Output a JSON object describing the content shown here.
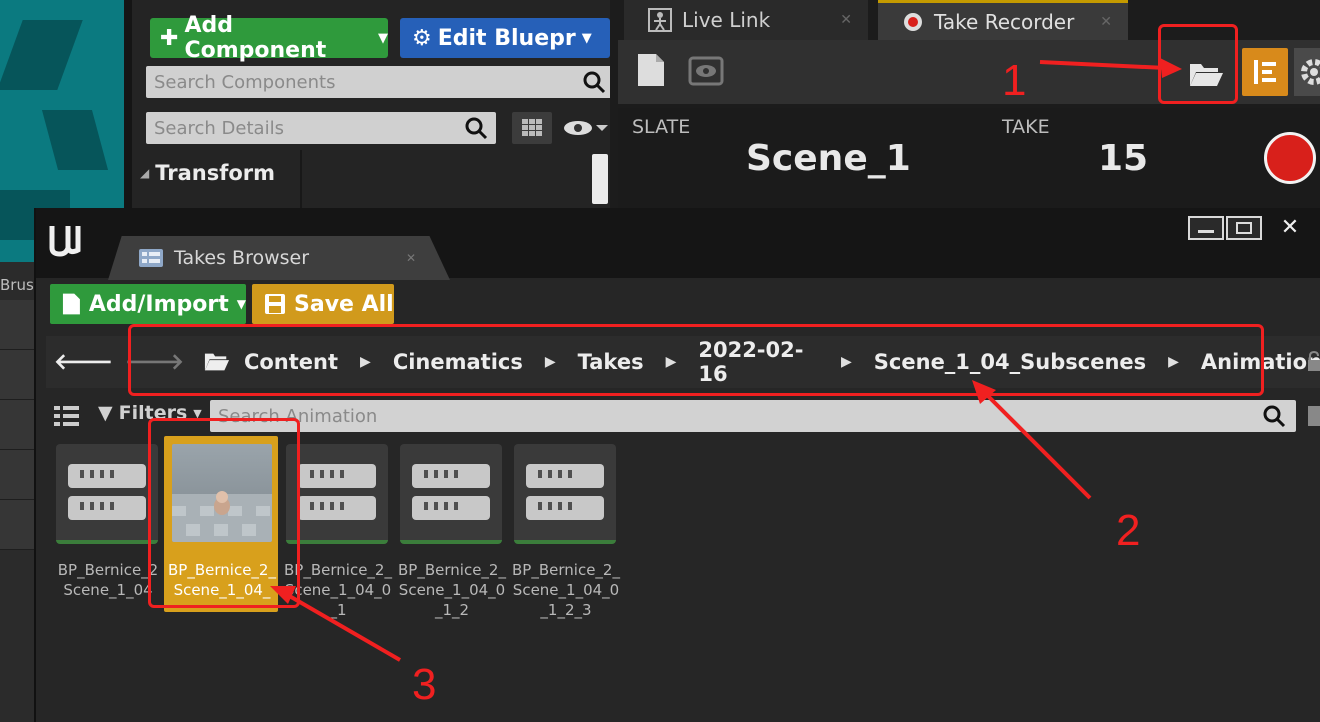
{
  "details": {
    "add_component": "Add Component",
    "edit_blueprint": "Edit Bluepr",
    "search_components_placeholder": "Search Components",
    "search_details_placeholder": "Search Details",
    "transform_label": "Transform"
  },
  "left": {
    "brush_label": "Brus"
  },
  "recorder": {
    "tab_live_link": "Live Link",
    "tab_take_recorder": "Take Recorder",
    "slate_label": "SLATE",
    "slate_value": "Scene_1",
    "take_label": "TAKE",
    "take_value": "15"
  },
  "takes_browser": {
    "tab_title": "Takes Browser",
    "add_import": "Add/Import",
    "save_all": "Save All",
    "breadcrumbs": [
      "Content",
      "Cinematics",
      "Takes",
      "2022-02-16",
      "Scene_1_04_Subscenes",
      "Animation"
    ],
    "filters_label": "Filters",
    "search_placeholder": "Search Animation",
    "assets": [
      {
        "name_line1": "BP_Bernice_2",
        "name_line2": "Scene_1_04"
      },
      {
        "name_line1": "BP_Bernice_2_",
        "name_line2": "Scene_1_04_"
      },
      {
        "name_line1": "BP_Bernice_2_",
        "name_line2": "Scene_1_04_0",
        "name_line3": "_1"
      },
      {
        "name_line1": "BP_Bernice_2_",
        "name_line2": "Scene_1_04_0",
        "name_line3": "_1_2"
      },
      {
        "name_line1": "BP_Bernice_2_",
        "name_line2": "Scene_1_04_0",
        "name_line3": "_1_2_3"
      }
    ]
  },
  "annotations": {
    "n1": "1",
    "n2": "2",
    "n3": "3"
  },
  "colors": {
    "annotation": "#f02020",
    "green_button": "#2f9a3c",
    "blue_button": "#2660b8",
    "selection": "#d8a01c",
    "record": "#d8201b"
  }
}
